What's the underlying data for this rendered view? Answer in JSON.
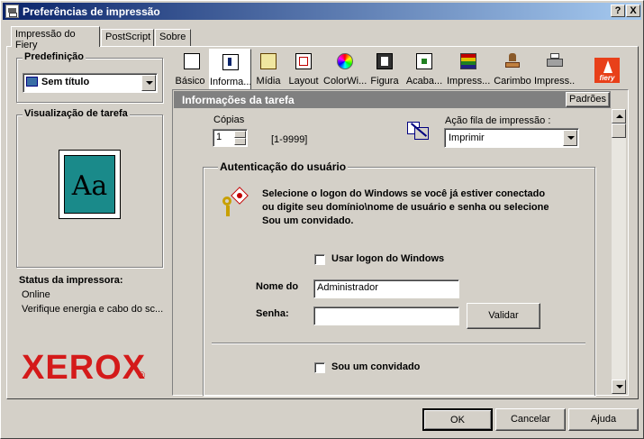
{
  "window": {
    "title": "Preferências de impressão",
    "help_button": "?",
    "close_button": "X"
  },
  "tabs": [
    {
      "label": "Impressão do Fiery"
    },
    {
      "label": "PostScript"
    },
    {
      "label": "Sobre"
    }
  ],
  "left_panel": {
    "preset_label": "Predefinição",
    "preset_value": "Sem título",
    "preview_label": "Visualização de tarefa",
    "preview_sample": "Aa",
    "printer_status_label": "Status da impressora:",
    "status_lines": [
      "Online",
      "Verifique energia e cabo do sc..."
    ],
    "brand_logo": "XEROX",
    "brand_registered": "®"
  },
  "toolbar": {
    "items": [
      {
        "label": "Básico",
        "icon": "page-icon"
      },
      {
        "label": "Informa...",
        "icon": "info-icon"
      },
      {
        "label": "Mídia",
        "icon": "media-icon"
      },
      {
        "label": "Layout",
        "icon": "layout-icon"
      },
      {
        "label": "ColorWi...",
        "icon": "colorwise-icon"
      },
      {
        "label": "Figura",
        "icon": "image-icon"
      },
      {
        "label": "Acaba...",
        "icon": "finishing-icon"
      },
      {
        "label": "Impress...",
        "icon": "print-quality-icon"
      },
      {
        "label": "Carimbo",
        "icon": "stamp-icon"
      },
      {
        "label": "Impress...",
        "icon": "printer-icon"
      }
    ],
    "fiery_logo": "fiery"
  },
  "section": {
    "title": "Informações da tarefa",
    "defaults_button": "Padrões"
  },
  "copies": {
    "label": "Cópias",
    "value": "1",
    "range": "[1-9999]"
  },
  "queue_action": {
    "label": "Ação fila de impressão :",
    "value": "Imprimir"
  },
  "auth": {
    "group_label": "Autenticação do usuário",
    "description": "Selecione o logon do Windows se você já estiver conectado ou digite seu domínio\\nome de usuário e senha ou selecione Sou um convidado.",
    "use_windows_logon_label": "Usar logon do Windows",
    "use_windows_logon_checked": false,
    "name_label": "Nome do",
    "name_value": "Administrador",
    "password_label": "Senha:",
    "password_value": "",
    "validate_button": "Validar",
    "guest_label": "Sou um convidado",
    "guest_checked": false
  },
  "footer": {
    "ok": "OK",
    "cancel": "Cancelar",
    "help": "Ajuda"
  }
}
